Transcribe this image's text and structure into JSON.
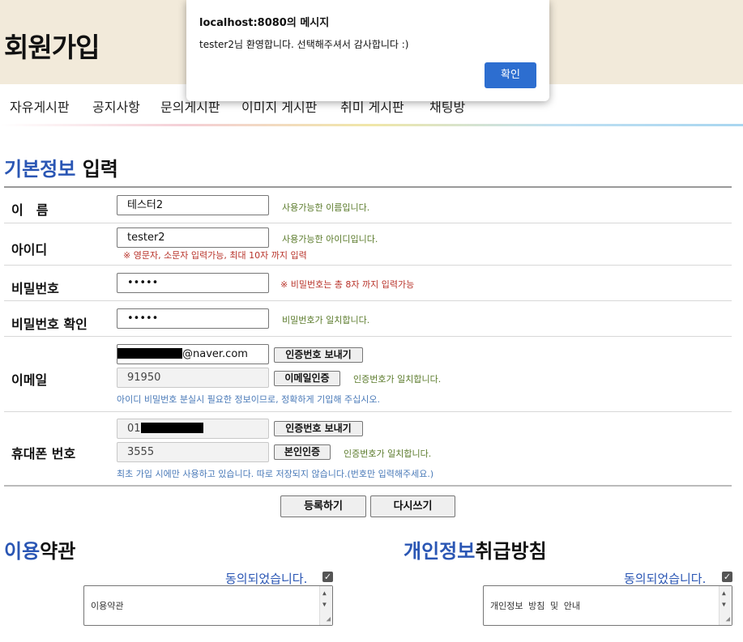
{
  "header": {
    "title": "회원가입"
  },
  "nav": {
    "items": [
      "자유게시판",
      "공지사항",
      "문의게시판",
      "이미지 게시판",
      "취미 게시판",
      "채팅방"
    ]
  },
  "form": {
    "section_title_highlight": "기본정보",
    "section_title_rest": "입력",
    "name": {
      "label": "이　름",
      "value": "테스터2",
      "message": "사용가능한 이름입니다."
    },
    "id": {
      "label": "아이디",
      "value": "tester2",
      "message": "사용가능한 아이디입니다.",
      "hint": "※ 영문자, 소문자 입력가능, 최대 10자 까지 입력"
    },
    "password": {
      "label": "비밀번호",
      "value": "•••••",
      "hint": "※ 비밀번호는 총 8자 까지 입력가능"
    },
    "password_confirm": {
      "label": "비밀번호 확인",
      "value": "•••••",
      "message": "비밀번호가 일치합니다."
    },
    "email": {
      "label": "이메일",
      "domain": "@naver.com",
      "send_button": "인증번호 보내기",
      "code_value": "91950",
      "verify_button": "이메일인증",
      "message": "인증번호가 일치합니다.",
      "note": "아이디 비밀번호 분실시 필요한 정보이므로, 정확하게 기입해 주십시오."
    },
    "phone": {
      "label": "휴대폰 번호",
      "prefix": "01",
      "send_button": "인증번호 보내기",
      "code_value": "3555",
      "verify_button": "본인인증",
      "message": "인증번호가 일치합니다.",
      "note": "최초 가입 시에만 사용하고 있습니다. 따로 저장되지 않습니다.(번호만 입력해주세요.)"
    },
    "submit_button": "등록하기",
    "reset_button": "다시쓰기"
  },
  "terms": {
    "title_highlight": "이용",
    "title_rest": "약관",
    "agree_text": "동의되었습니다.",
    "checked": true,
    "textarea": "이용약관"
  },
  "privacy": {
    "title_highlight": "개인정보",
    "title_rest": "취급방침",
    "agree_text": "동의되었습니다.",
    "checked": true,
    "textarea": "개인정보 방침 및 안내"
  },
  "dialog": {
    "title": "localhost:8080의 메시지",
    "message": "tester2님 환영합니다. 선택해주셔서 감사합니다 :)",
    "ok_button": "확인"
  },
  "colors": {
    "header_bg": "#f2eada",
    "accent_blue": "#2a56b4",
    "dialog_button": "#2d6ed0"
  }
}
